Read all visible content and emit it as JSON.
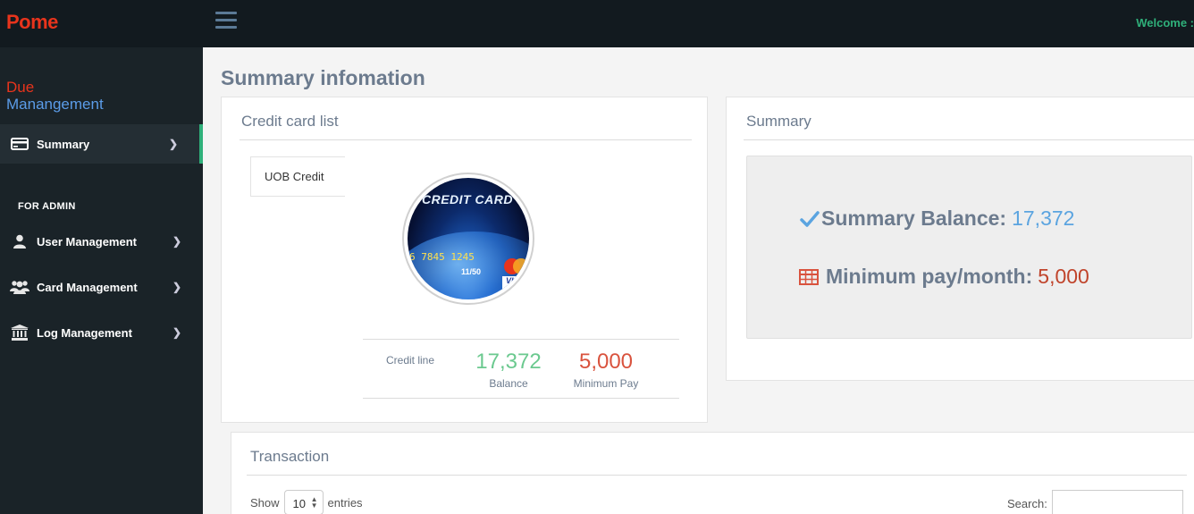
{
  "header": {
    "brand": "Pome",
    "welcome": "Welcome :"
  },
  "sidebar": {
    "app_title_line1": "Due",
    "app_title_line2": "Manangement",
    "items": [
      {
        "label": "Summary",
        "icon": "credit-card-icon",
        "active": true
      }
    ],
    "admin_heading": "FOR ADMIN",
    "admin_items": [
      {
        "label": "User Management",
        "icon": "user-icon"
      },
      {
        "label": "Card Management",
        "icon": "users-icon"
      },
      {
        "label": "Log Management",
        "icon": "bank-icon"
      }
    ]
  },
  "main": {
    "page_title": "Summary infomation",
    "credit_card_panel": {
      "title": "Credit card list",
      "cards": [
        {
          "name": "UOB Credit"
        }
      ],
      "card_image": {
        "title_text": "CREDIT CARD",
        "number_text": "6 7845 1245",
        "expiry_text": "11/50",
        "visa_text": "VISA"
      },
      "stats": [
        {
          "value": "",
          "label": "Credit line",
          "color": "#6c7b8e"
        },
        {
          "value": "17,372",
          "label": "Balance",
          "color": "#6bc98f"
        },
        {
          "value": "5,000",
          "label": "Minimum Pay",
          "color": "#d9533e"
        }
      ]
    },
    "summary_panel": {
      "title": "Summary",
      "balance_label": "Summary Balance:",
      "balance_value": "17,372",
      "balance_color": "#5ba4e0",
      "min_pay_label": "Minimum pay/month:",
      "min_pay_value": "5,000",
      "min_pay_color": "#c0442b"
    },
    "transaction_panel": {
      "title": "Transaction",
      "show_label": "Show",
      "page_length": "10",
      "entries_label": "entries",
      "search_label": "Search:",
      "search_value": ""
    }
  }
}
